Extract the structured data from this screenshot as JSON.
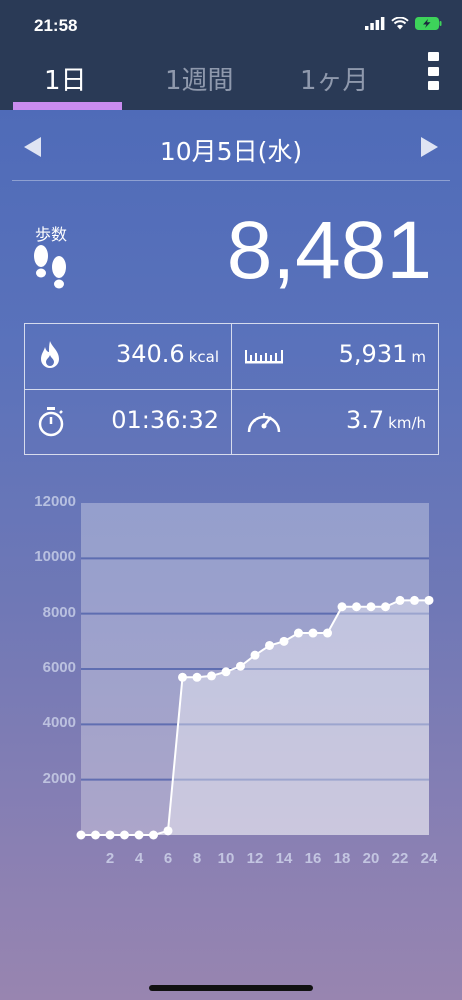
{
  "status_bar": {
    "time": "21:58"
  },
  "tabs": [
    {
      "label": "1日",
      "active": true
    },
    {
      "label": "1週間",
      "active": false
    },
    {
      "label": "1ヶ月",
      "active": false
    }
  ],
  "date_nav": {
    "label": "10月5日(水)"
  },
  "steps": {
    "label": "歩数",
    "value": "8,481"
  },
  "stats": {
    "calories": {
      "value": "340.6",
      "unit": "kcal"
    },
    "distance": {
      "value": "5,931",
      "unit": "m"
    },
    "duration": {
      "value": "01:36:32"
    },
    "speed": {
      "value": "3.7",
      "unit": "km/h"
    }
  },
  "icons": {
    "steps": "footprints-icon",
    "calories": "flame-icon",
    "distance": "ruler-icon",
    "duration": "stopwatch-icon",
    "speed": "speedometer-icon",
    "menu": "more-vertical-icon"
  },
  "colors": {
    "tab_accent": "#c98cf0",
    "header_bg": "#2a3a56"
  },
  "chart_data": {
    "type": "area",
    "y_ticks": [
      "2000",
      "4000",
      "6000",
      "8000",
      "10000",
      "12000"
    ],
    "x_ticks": [
      "2",
      "4",
      "6",
      "8",
      "10",
      "12",
      "14",
      "16",
      "18",
      "20",
      "22",
      "24"
    ],
    "ylim": [
      0,
      12000
    ],
    "xlim": [
      0,
      24
    ],
    "grid": true,
    "x": [
      0,
      1,
      2,
      3,
      4,
      5,
      6,
      7,
      8,
      9,
      10,
      11,
      12,
      13,
      14,
      15,
      16,
      17,
      18,
      19,
      20,
      21,
      22,
      23,
      24
    ],
    "values": [
      0,
      0,
      0,
      0,
      0,
      0,
      150,
      5700,
      5700,
      5750,
      5900,
      6100,
      6500,
      6850,
      7000,
      7300,
      7300,
      7300,
      8250,
      8250,
      8250,
      8250,
      8480,
      8480,
      8481
    ]
  }
}
